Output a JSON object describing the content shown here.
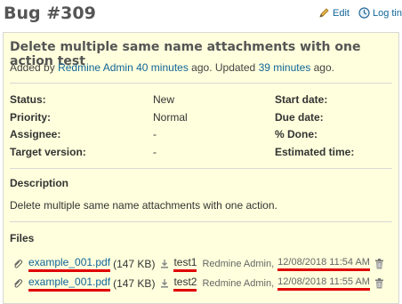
{
  "page": {
    "title": "Bug #309"
  },
  "actions": {
    "edit_label": "Edit",
    "logtime_label": "Log tin"
  },
  "issue": {
    "subject": "Delete multiple same name attachments with one action test",
    "author_prefix": "Added by",
    "author_name": "Redmine Admin",
    "created_ago": "40 minutes",
    "updated_text": "ago. Updated",
    "updated_ago": "39 minutes",
    "ago_suffix": "ago.",
    "attributes": {
      "status_label": "Status:",
      "status_value": "New",
      "priority_label": "Priority:",
      "priority_value": "Normal",
      "assignee_label": "Assignee:",
      "assignee_value": "-",
      "target_version_label": "Target version:",
      "target_version_value": "-",
      "start_date_label": "Start date:",
      "due_date_label": "Due date:",
      "done_label": "% Done:",
      "estimated_time_label": "Estimated time:"
    },
    "description_heading": "Description",
    "description": "Delete multiple same name attachments with one action.",
    "files_heading": "Files",
    "files": [
      {
        "name": "example_001.pdf",
        "size": "(147 KB)",
        "description": "test1",
        "author": "Redmine Admin,",
        "timestamp": "12/08/2018 11:54 AM"
      },
      {
        "name": "example_001.pdf",
        "size": "(147 KB)",
        "description": "test2",
        "author": "Redmine Admin,",
        "timestamp": "12/08/2018 11:55 AM"
      }
    ]
  },
  "colors": {
    "link": "#116699",
    "highlight_underline": "#e00000",
    "issue_background": "#ffffdd"
  }
}
